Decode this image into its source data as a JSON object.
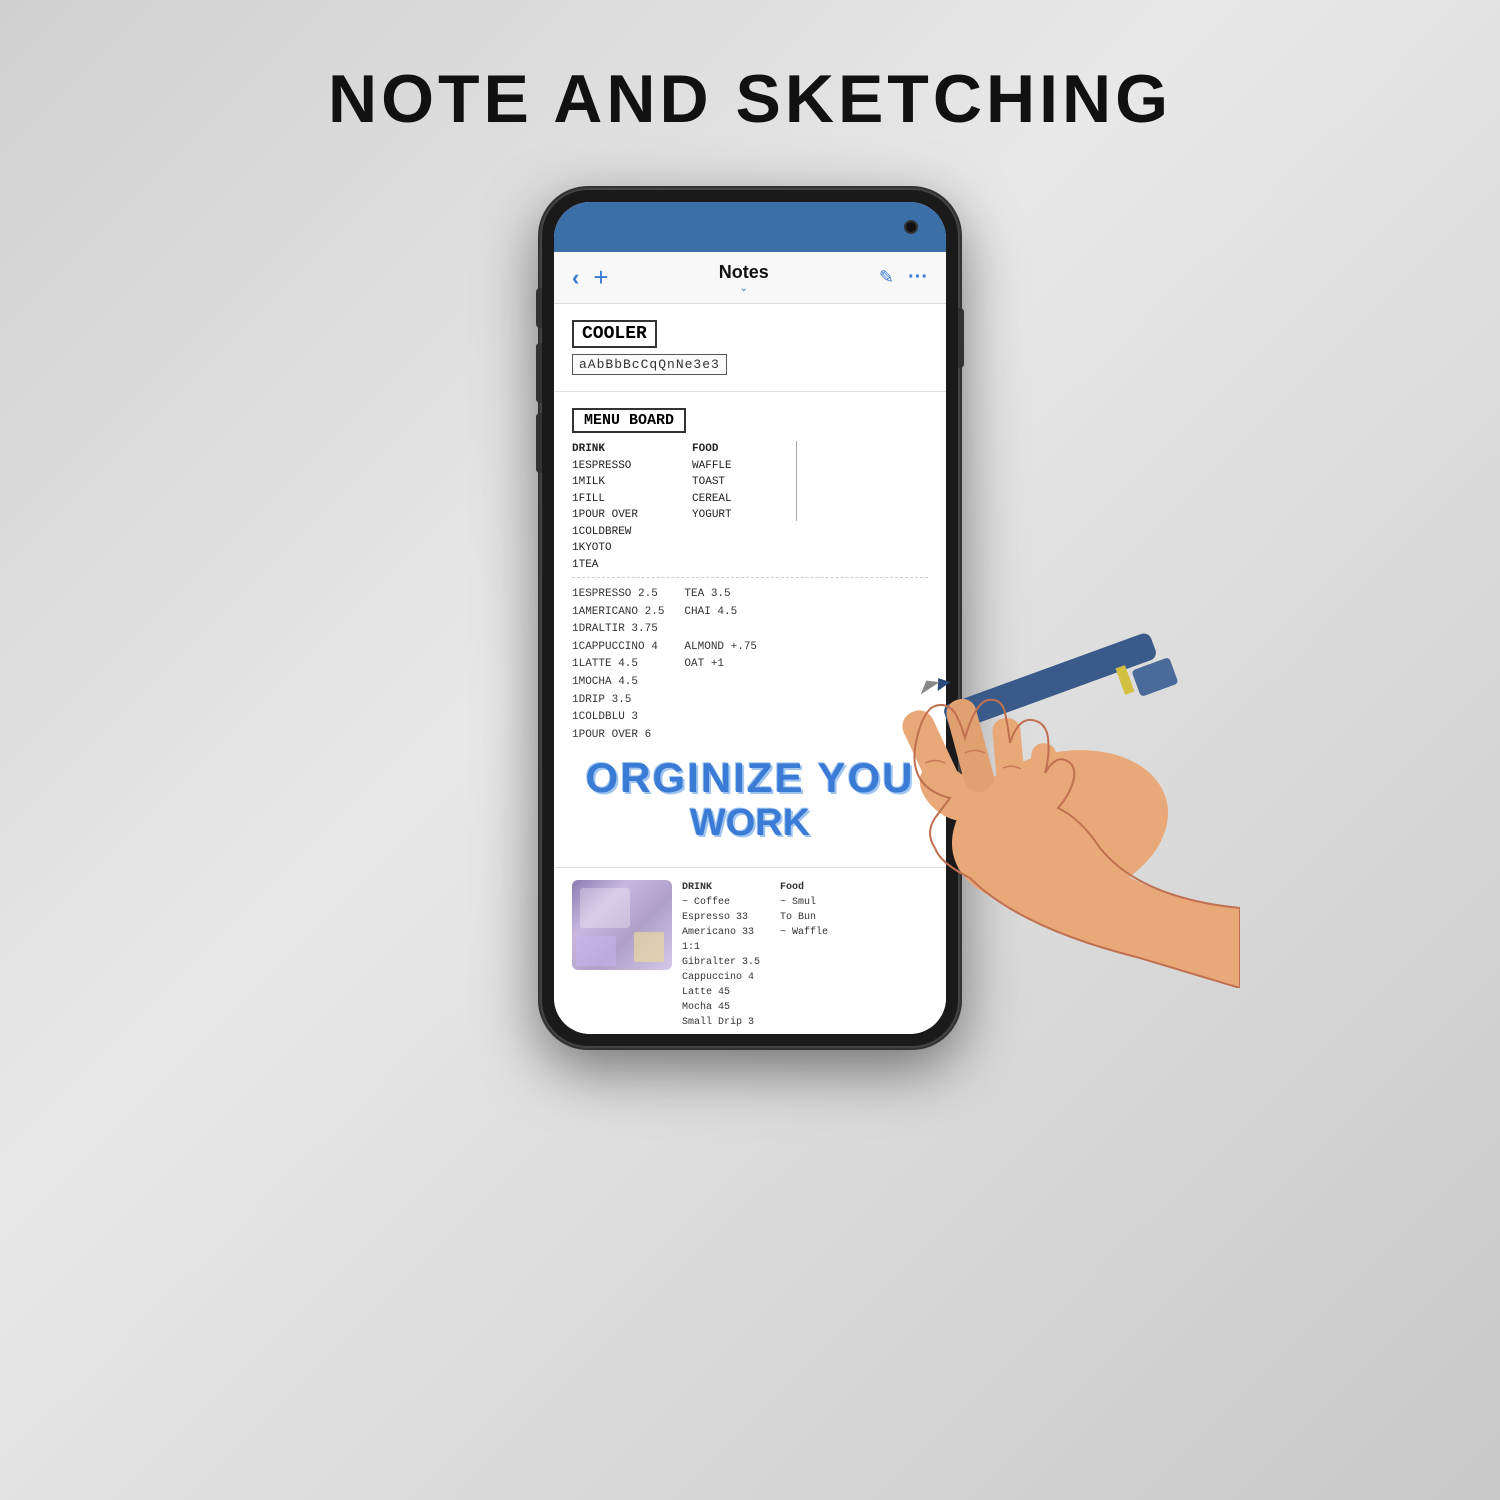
{
  "page": {
    "title": "NOTE AND SKETCHING",
    "nav": {
      "back_label": "‹",
      "add_label": "+",
      "title": "Notes",
      "chevron_down": "⌄",
      "edit_icon": "✎",
      "dots": "···"
    },
    "notes": [
      {
        "id": "cooler-note",
        "box_label": "COOLER",
        "code_text": "aAbBbBcCqQnNe3e3",
        "type": "sketched"
      },
      {
        "id": "menu-note",
        "box_label": "MENU BOARD",
        "drinks": [
          "DRINK",
          "1ESPRESSO",
          "1MILK",
          "1FILL",
          "1POUR OVER",
          "1COLDBREW",
          "1KYOTO",
          "1TEA"
        ],
        "foods": [
          "FOOD",
          "WAFFLE",
          "TOAST",
          "CEREAL",
          "YOGURT"
        ],
        "section2_left": [
          "1ESPRESSO  2.5",
          "1AMERICANO  2.5",
          "1DRALTIR  3.75",
          "1CAPPUCCINO  4",
          "1LATTE  4.5",
          "1MOCHA  4.5",
          "1DRIP  3.5",
          "1COLDBLU  3",
          "1POUR OVER  6"
        ],
        "section2_right": [
          "TEA  3.5",
          "CHAI  4.5",
          "",
          "ALMOND +.75",
          "OAT  +1"
        ]
      }
    ],
    "organize": {
      "line1": "ORGiNiZE YOU",
      "line2": "wORk"
    },
    "bottom_note": {
      "drink_header": "DRINK",
      "food_header": "Food",
      "items": [
        "~ Coffee",
        "Espresso  33",
        "Americano  33",
        "1:1",
        "Gibralter  3.5",
        "Cappuccino  4",
        "Latte  45",
        "Mocha  45",
        "Small Drip  3"
      ],
      "food_items": [
        "~ Smul",
        "To Bun",
        "~ Waffle"
      ]
    }
  }
}
